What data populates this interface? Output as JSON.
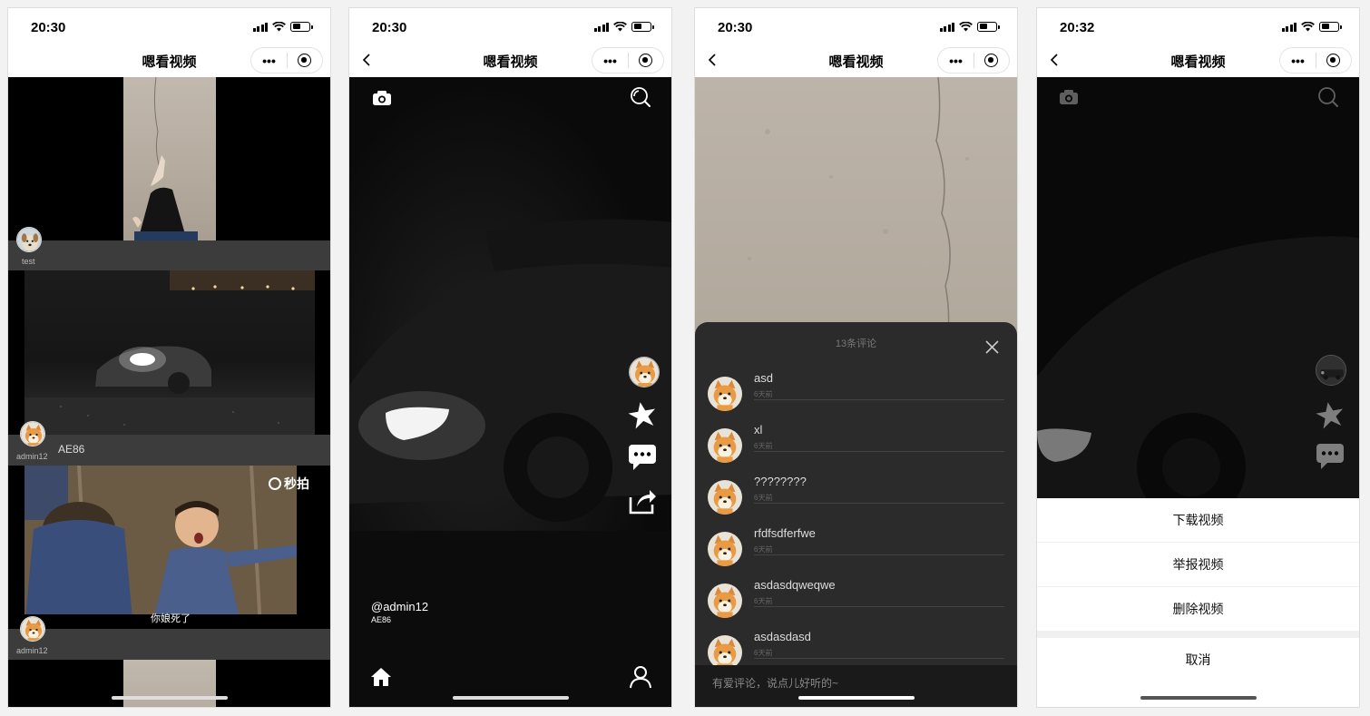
{
  "status": {
    "time1": "20:30",
    "time2": "20:30",
    "time3": "20:30",
    "time4": "20:32"
  },
  "app_title": "嗯看视频",
  "capsule": {
    "more": "•••"
  },
  "feed": {
    "items": [
      {
        "user": "test",
        "title": ""
      },
      {
        "user": "admin12",
        "title": "AE86"
      },
      {
        "user": "admin12",
        "title": ""
      }
    ],
    "subtitle": "你娘死了",
    "watermark": "秒拍"
  },
  "player": {
    "owner": "@admin12",
    "desc": "AE86"
  },
  "comments": {
    "count": "13条评论",
    "items": [
      {
        "text": "asd",
        "time": "6天前"
      },
      {
        "text": "xl",
        "time": "6天前"
      },
      {
        "text": "????????",
        "time": "6天前"
      },
      {
        "text": "rfdfsdferfwe",
        "time": "6天前"
      },
      {
        "text": "asdasdqweqwe",
        "time": "6天前"
      },
      {
        "text": "asdasdasd",
        "time": "6天前"
      }
    ],
    "placeholder": "有爱评论，说点儿好听的~"
  },
  "sheet": {
    "options": [
      "下载视频",
      "举报视频",
      "删除视频"
    ],
    "cancel": "取消"
  }
}
